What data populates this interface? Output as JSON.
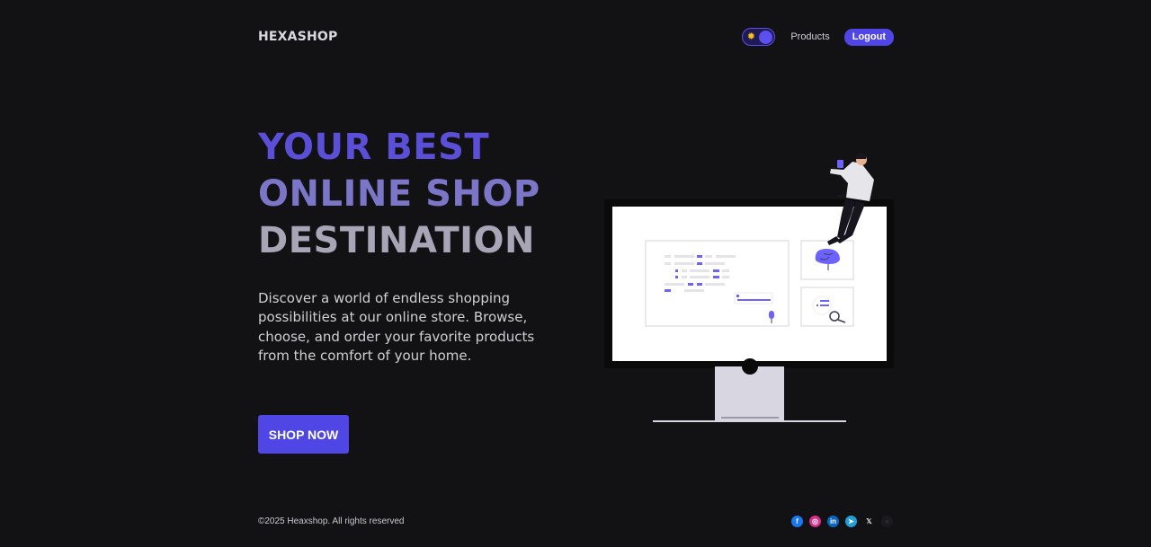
{
  "header": {
    "brand": "HEXASHOP",
    "theme_toggle_icon": "sun-icon",
    "nav_products": "Products",
    "logout_label": "Logout"
  },
  "hero": {
    "title_line1": "YOUR BEST",
    "title_line2": "ONLINE SHOP",
    "title_line3": "DESTINATION",
    "description": "Discover a world of endless shopping possibilities at our online store. Browse, choose, and order your favorite products from the comfort of your home.",
    "cta_label": "SHOP NOW",
    "illustration": "person-sitting-on-monitor-illustration"
  },
  "footer": {
    "copyright": "©2025 Heaxshop. All rights reserved",
    "social_icons": [
      "facebook-icon",
      "instagram-icon",
      "linkedin-icon",
      "telegram-icon",
      "x-icon",
      "github-icon"
    ]
  },
  "colors": {
    "background": "#121113",
    "accent": "#4f46e5",
    "title_line1": "#5b4fd8",
    "title_line2": "#7c76c8",
    "title_line3": "#a7a5b6"
  }
}
